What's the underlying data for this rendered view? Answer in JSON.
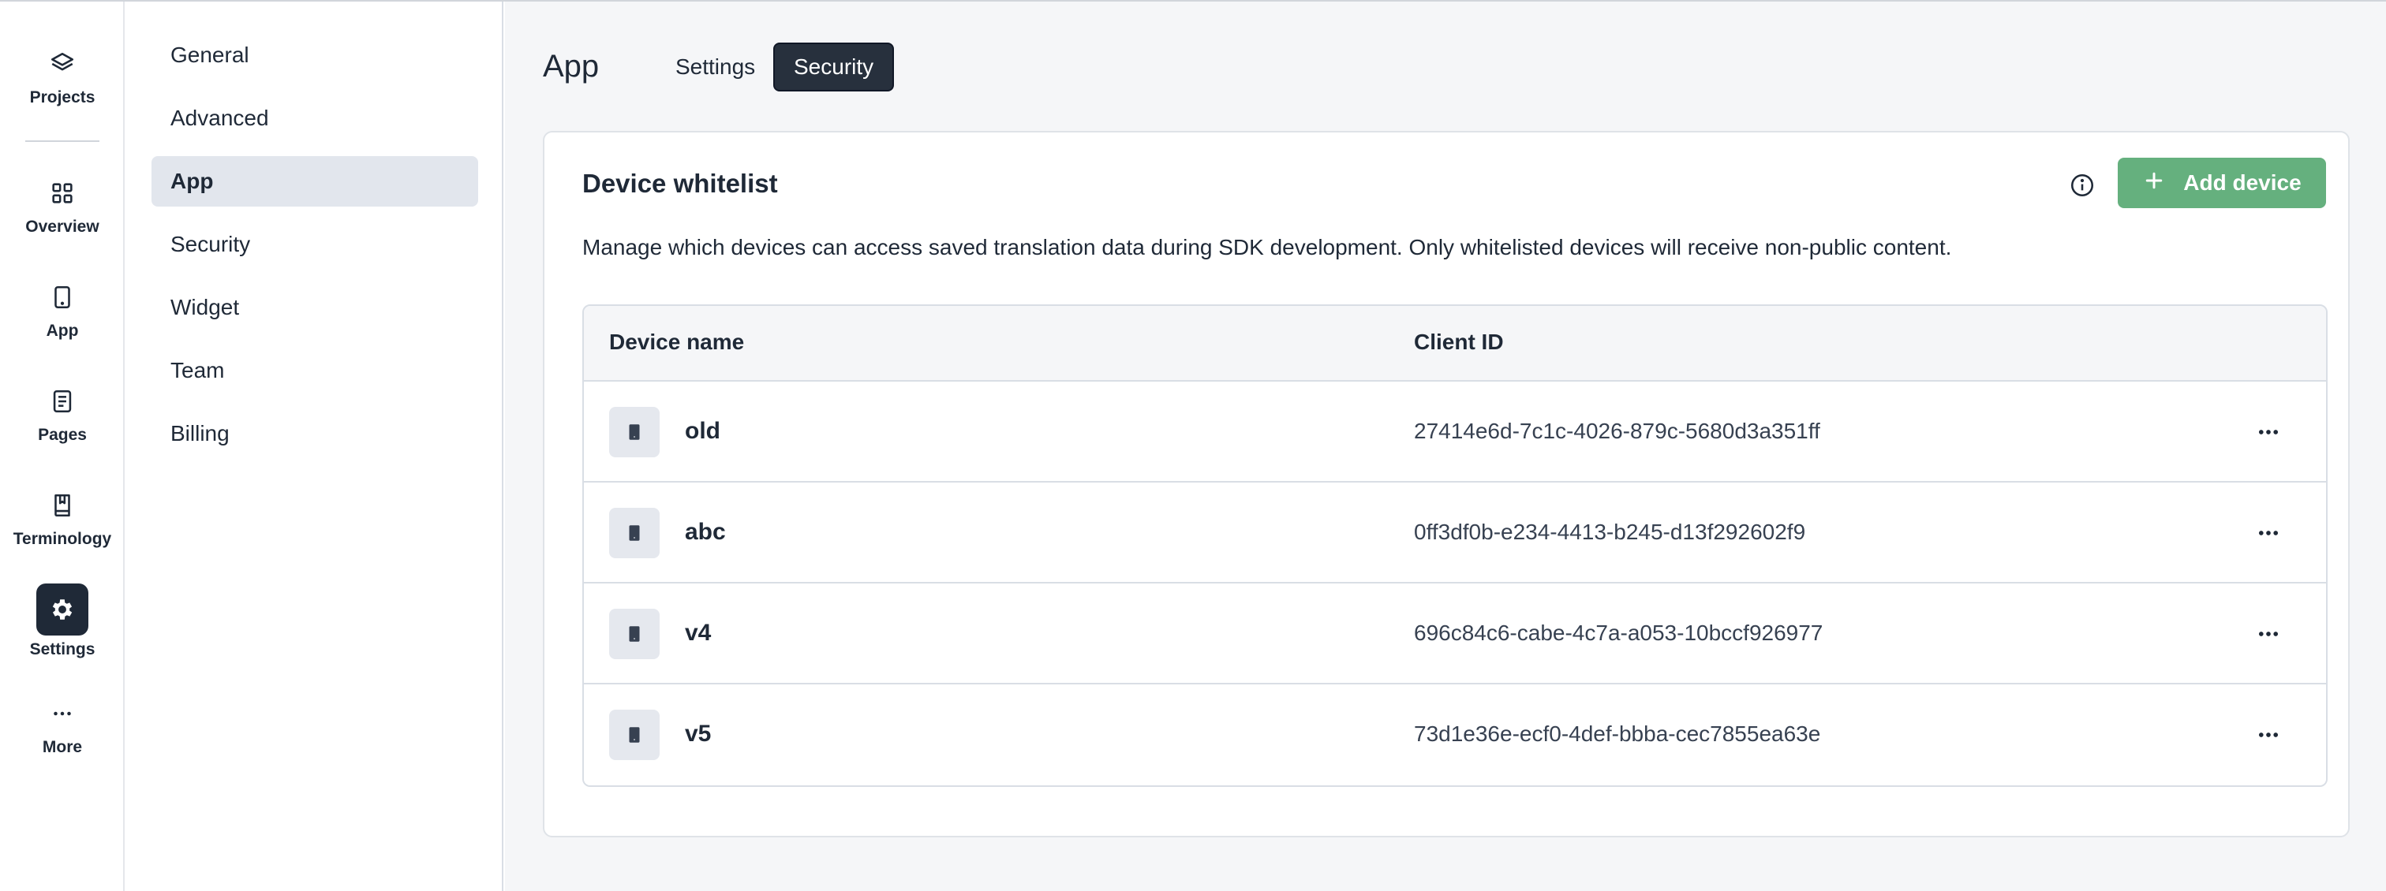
{
  "rail": {
    "items": [
      {
        "label": "Projects",
        "icon": "layers-icon"
      },
      {
        "label": "Overview",
        "icon": "grid-icon"
      },
      {
        "label": "App",
        "icon": "phone-icon"
      },
      {
        "label": "Pages",
        "icon": "document-icon"
      },
      {
        "label": "Terminology",
        "icon": "book-icon"
      },
      {
        "label": "Settings",
        "icon": "gear-icon",
        "active": true
      },
      {
        "label": "More",
        "icon": "more-icon"
      }
    ]
  },
  "subnav": {
    "items": [
      {
        "label": "General"
      },
      {
        "label": "Advanced"
      },
      {
        "label": "App",
        "active": true
      },
      {
        "label": "Security"
      },
      {
        "label": "Widget"
      },
      {
        "label": "Team"
      },
      {
        "label": "Billing"
      }
    ]
  },
  "header": {
    "title": "App",
    "tabs": [
      {
        "label": "Settings"
      },
      {
        "label": "Security",
        "active": true
      }
    ]
  },
  "card": {
    "title": "Device whitelist",
    "add_button": "Add device",
    "description": "Manage which devices can access saved translation data during SDK development. Only whitelisted devices will receive non-public content.",
    "columns": [
      "Device name",
      "Client ID"
    ],
    "rows": [
      {
        "name": "old",
        "client_id": "27414e6d-7c1c-4026-879c-5680d3a351ff"
      },
      {
        "name": "abc",
        "client_id": "0ff3df0b-e234-4413-b245-d13f292602f9"
      },
      {
        "name": "v4",
        "client_id": "696c84c6-cabe-4c7a-a053-10bccf926977"
      },
      {
        "name": "v5",
        "client_id": "73d1e36e-ecf0-4def-bbba-cec7855ea63e"
      }
    ]
  },
  "colors": {
    "accent_green": "#65b07e",
    "dark": "#27303d",
    "active_nav_bg": "#e2e6ed",
    "main_bg": "#f5f6f8"
  }
}
